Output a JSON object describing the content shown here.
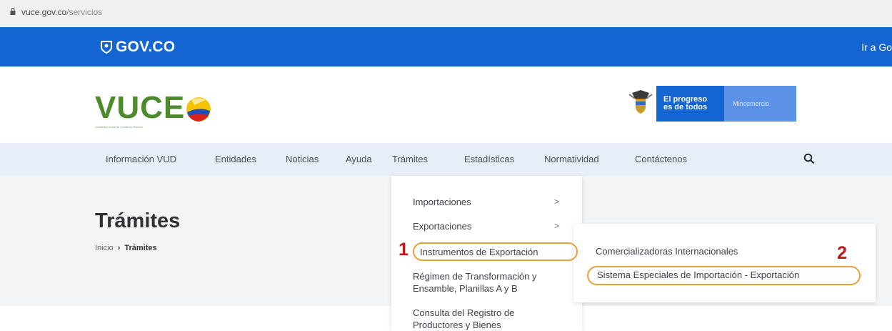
{
  "browser": {
    "url_domain": "vuce.gov.co",
    "url_path": "/servicios"
  },
  "govbar": {
    "logo_text": "GOV.CO",
    "goto_text": "Ir a Go"
  },
  "header": {
    "logo_text": "VUCE",
    "logo_tagline": "Ventanilla Única de Comercio Exterior",
    "progreso_line1": "El progreso",
    "progreso_line2": "es de todos",
    "ministry": "Mincomercio"
  },
  "nav": {
    "items": [
      "Información VUD",
      "Entidades",
      "Noticias",
      "Ayuda",
      "Trámites",
      "Estadísticas",
      "Normatividad",
      "Contáctenos"
    ]
  },
  "page": {
    "title": "Trámites",
    "breadcrumb_home": "Inicio",
    "breadcrumb_current": "Trámites"
  },
  "dropdown": {
    "items": [
      "Importaciones",
      "Exportaciones",
      "Instrumentos de Exportación",
      "Régimen de Transformación y",
      "Ensamble, Planillas A y B",
      "Consulta del Registro de",
      "Productores y Bienes"
    ]
  },
  "submenu": {
    "items": [
      "Comercializadoras Internacionales",
      "Sistema Especiales de Importación - Exportación"
    ]
  },
  "annotations": {
    "marker1": "1",
    "marker2": "2",
    "highlight_color": "#e9a23b",
    "marker_color": "#c0171b"
  },
  "colors": {
    "gov_blue": "#1464d2",
    "vuce_green": "#4d8a2b",
    "nav_bg": "#e6eef8"
  }
}
